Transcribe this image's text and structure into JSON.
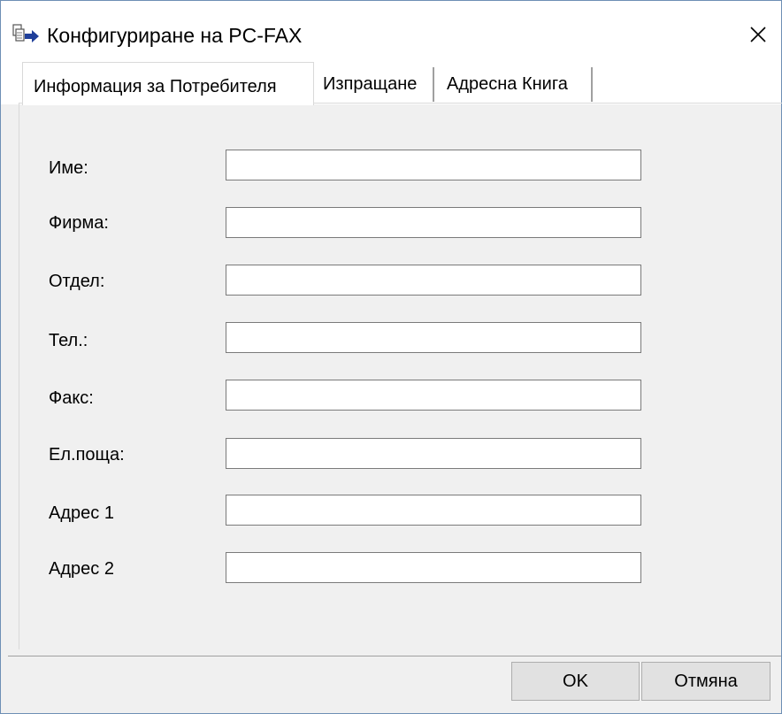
{
  "window": {
    "title": "Конфигуриране на PC-FAX",
    "icon": "pc-fax-icon",
    "close_icon": "close-icon"
  },
  "tabs": [
    {
      "label": "Информация за Потребителя",
      "active": true
    },
    {
      "label": "Изпращане",
      "active": false
    },
    {
      "label": "Адресна Книга",
      "active": false
    }
  ],
  "form": {
    "fields": [
      {
        "label": "Име:",
        "value": ""
      },
      {
        "label": "Фирма:",
        "value": ""
      },
      {
        "label": "Отдел:",
        "value": ""
      },
      {
        "label": "Тел.:",
        "value": ""
      },
      {
        "label": "Факс:",
        "value": ""
      },
      {
        "label": "Ел.поща:",
        "value": ""
      },
      {
        "label": "Адрес 1",
        "value": ""
      },
      {
        "label": "Адрес 2",
        "value": ""
      }
    ]
  },
  "buttons": {
    "ok": "OK",
    "cancel": "Отмяна"
  }
}
